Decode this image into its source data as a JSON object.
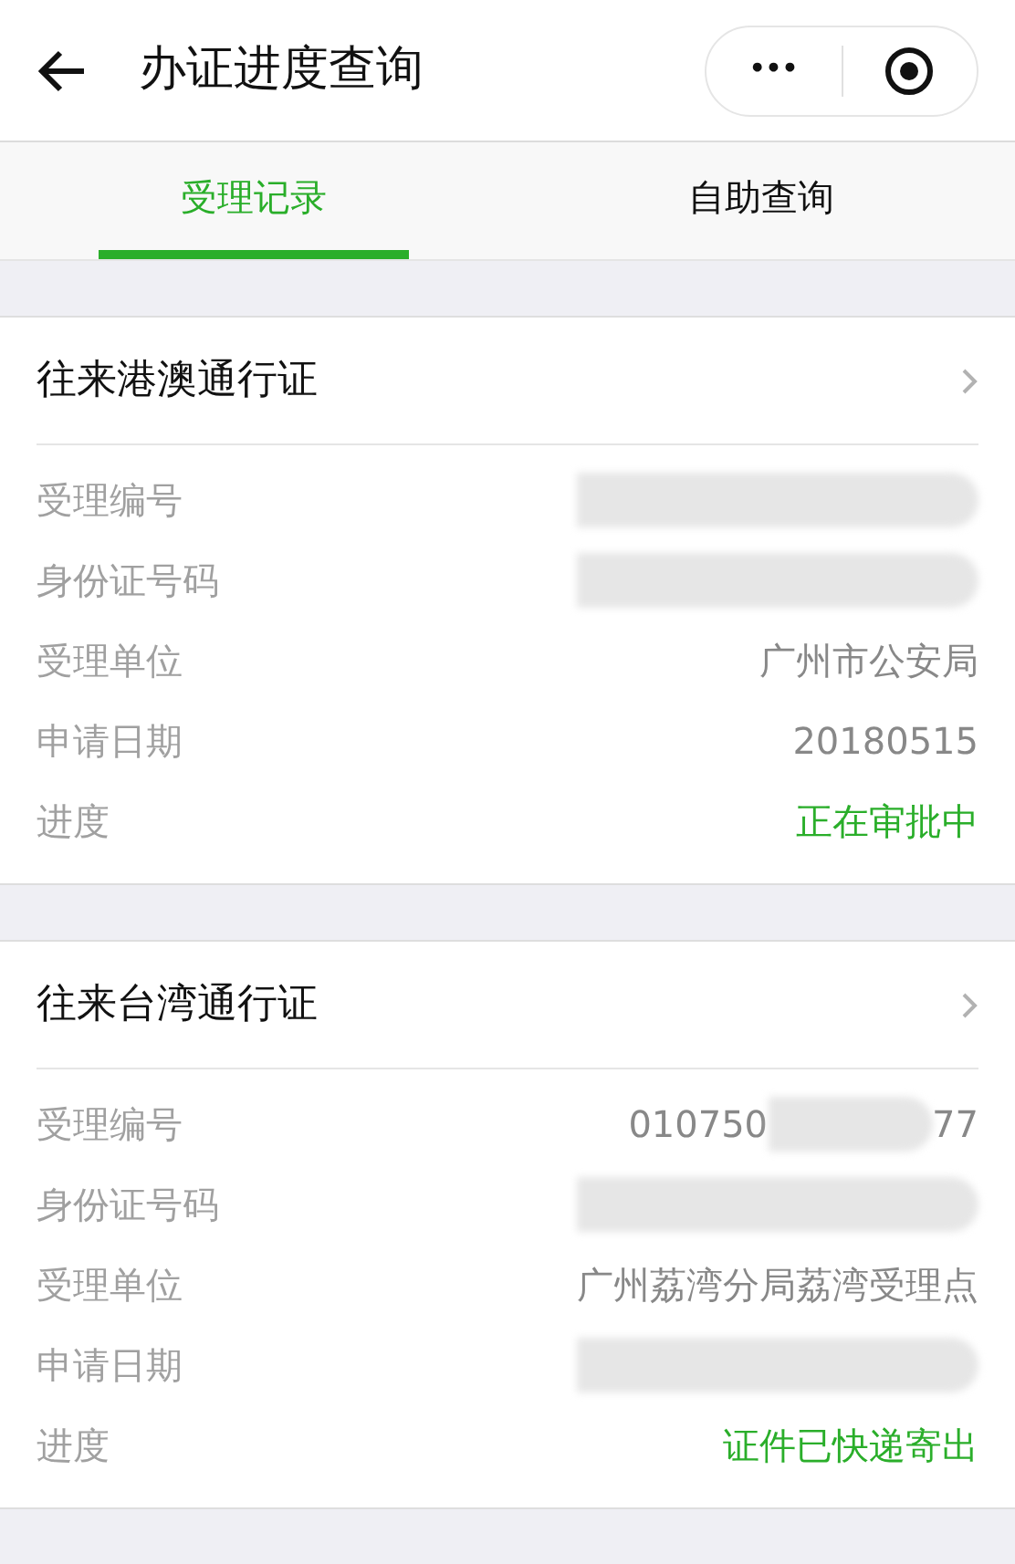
{
  "header": {
    "title": "办证进度查询",
    "more_button": "•••"
  },
  "tabs": [
    {
      "label": "受理记录",
      "selected": true
    },
    {
      "label": "自助查询",
      "selected": false
    }
  ],
  "records": [
    {
      "title": "往来港澳通行证",
      "fields": [
        {
          "label": "受理编号",
          "kind": "redacted"
        },
        {
          "label": "身份证号码",
          "kind": "redacted"
        },
        {
          "label": "受理单位",
          "kind": "text",
          "value": "广州市公安局"
        },
        {
          "label": "申请日期",
          "kind": "text",
          "value": "20180515"
        },
        {
          "label": "进度",
          "kind": "status",
          "value": "正在审批中"
        }
      ]
    },
    {
      "title": "往来台湾通行证",
      "fields": [
        {
          "label": "受理编号",
          "kind": "partial",
          "prefix": "010750",
          "suffix": "77"
        },
        {
          "label": "身份证号码",
          "kind": "redacted"
        },
        {
          "label": "受理单位",
          "kind": "text",
          "value": "广州荔湾分局荔湾受理点"
        },
        {
          "label": "申请日期",
          "kind": "redacted"
        },
        {
          "label": "进度",
          "kind": "status",
          "value": "证件已快递寄出"
        }
      ]
    }
  ]
}
